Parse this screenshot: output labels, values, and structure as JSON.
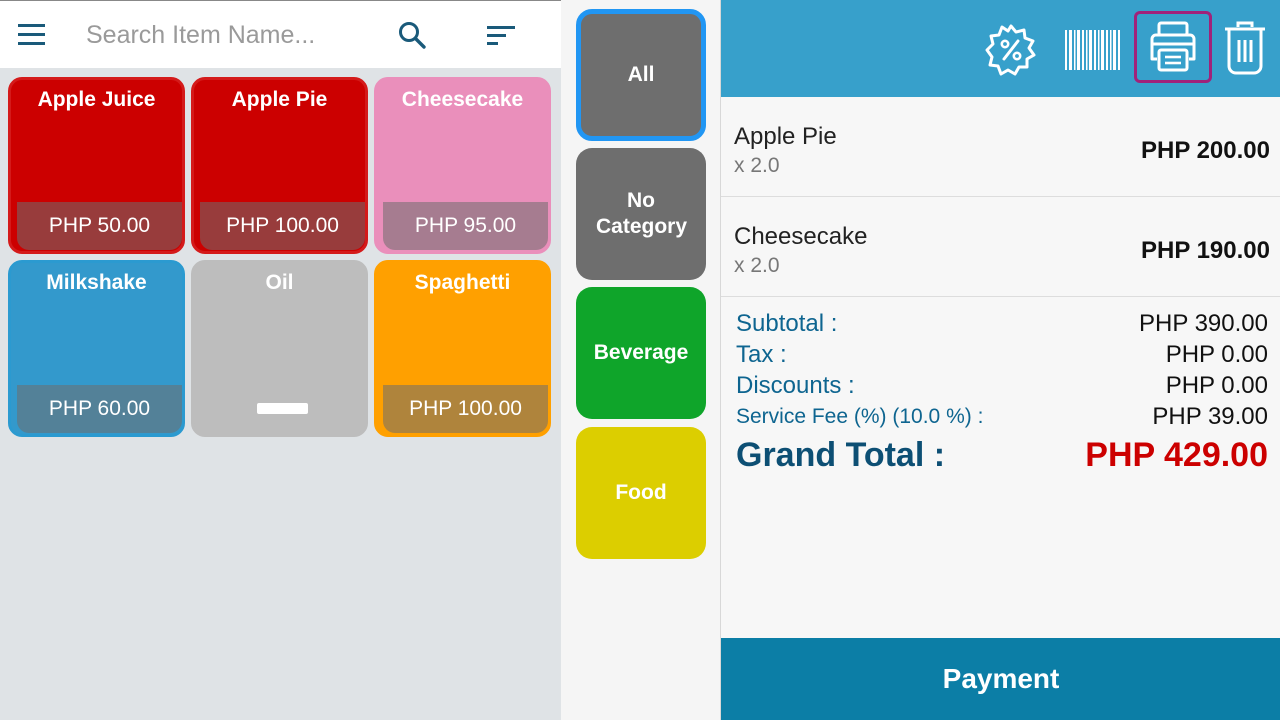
{
  "search": {
    "placeholder": "Search Item Name..."
  },
  "items": [
    {
      "name": "Apple Juice",
      "price": "PHP 50.00",
      "color": "#cc0000",
      "border": "#d41a1a"
    },
    {
      "name": "Apple Pie",
      "price": "PHP 100.00",
      "color": "#cc0000",
      "border": "#d41a1a"
    },
    {
      "name": "Cheesecake",
      "price": "PHP 95.00",
      "color": "#ea8fbb",
      "border": "#ea8fbb"
    },
    {
      "name": "Milkshake",
      "price": "PHP 60.00",
      "color": "#3399cc",
      "border": "#2b9ad0"
    },
    {
      "name": "Oil",
      "price": "",
      "color": "#bdbdbd",
      "border": "#bdbdbd"
    },
    {
      "name": "Spaghetti",
      "price": "PHP 100.00",
      "color": "#ffa000",
      "border": "#ffa000"
    }
  ],
  "categories": [
    {
      "label": "All",
      "color": "#6e6e6e",
      "selected": true
    },
    {
      "label": "No Category",
      "color": "#6e6e6e",
      "selected": false
    },
    {
      "label": "Beverage",
      "color": "#0fa52a",
      "selected": false
    },
    {
      "label": "Food",
      "color": "#dcce00",
      "selected": false
    }
  ],
  "toolbar": {
    "icons": [
      "discount-badge-icon",
      "barcode-icon",
      "printer-icon",
      "trash-icon"
    ],
    "color": "#37a0cb"
  },
  "cart": [
    {
      "name": "Apple Pie",
      "qty": "x 2.0",
      "price": "PHP 200.00"
    },
    {
      "name": "Cheesecake",
      "qty": "x 2.0",
      "price": "PHP 190.00"
    }
  ],
  "totals": {
    "subtotal_label": "Subtotal :",
    "subtotal_value": "PHP 390.00",
    "tax_label": "Tax :",
    "tax_value": "PHP 0.00",
    "discounts_label": "Discounts :",
    "discounts_value": "PHP 0.00",
    "fee_label": "Service Fee (%) (10.0 %) :",
    "fee_value": "PHP 39.00",
    "grand_label": "Grand Total :",
    "grand_value": "PHP 429.00"
  },
  "payment": {
    "label": "Payment",
    "color": "#0c7ea6"
  }
}
